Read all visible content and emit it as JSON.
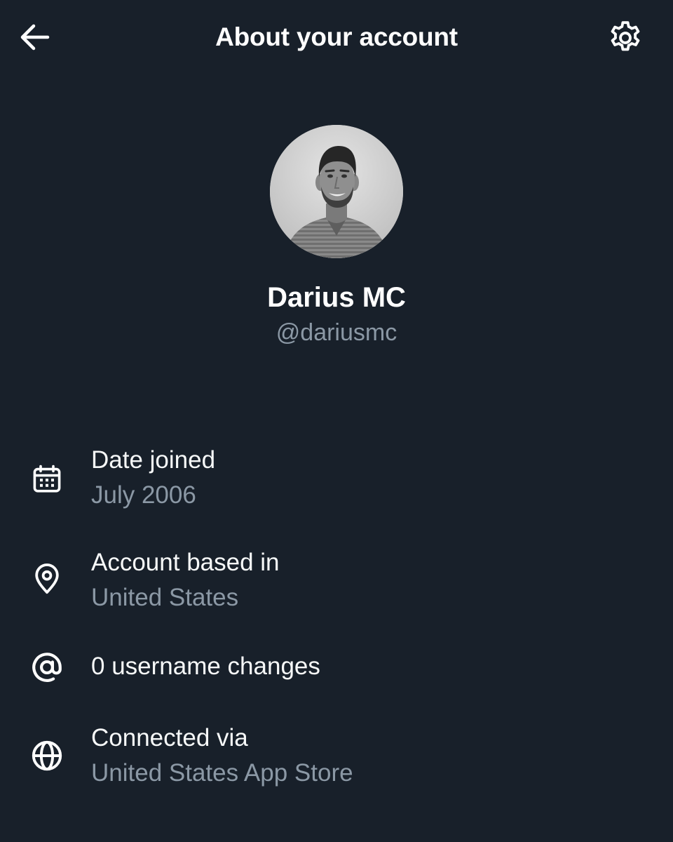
{
  "header": {
    "title": "About your account",
    "back_icon": "arrow-left-icon",
    "settings_icon": "gear-icon"
  },
  "profile": {
    "display_name": "Darius MC",
    "handle": "@dariusmc"
  },
  "info": {
    "date_joined": {
      "icon": "calendar-icon",
      "label": "Date joined",
      "value": "July 2006"
    },
    "account_based_in": {
      "icon": "location-pin-icon",
      "label": "Account based in",
      "value": "United States"
    },
    "username_changes": {
      "icon": "at-sign-icon",
      "label": "0 username changes"
    },
    "connected_via": {
      "icon": "globe-icon",
      "label": "Connected via",
      "value": "United States App Store"
    }
  },
  "colors": {
    "background": "#18202a",
    "primary_text": "#ffffff",
    "secondary_text": "#8b98a5"
  }
}
